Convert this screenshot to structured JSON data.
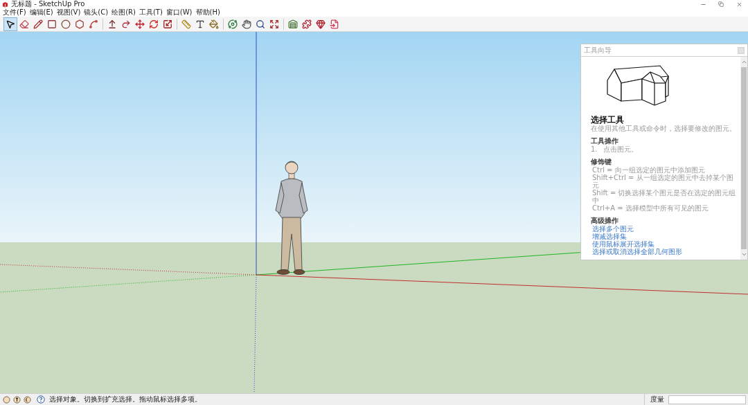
{
  "window": {
    "title": "无标题 - SketchUp Pro"
  },
  "menu_bar": [
    "文件(F)",
    "编辑(E)",
    "视图(V)",
    "镜头(C)",
    "绘图(R)",
    "工具(T)",
    "窗口(W)",
    "帮助(H)"
  ],
  "toolbar": {
    "groups": [
      [
        {
          "kind": "select",
          "selected": true
        },
        {
          "kind": "eraser",
          "selected": false
        },
        {
          "kind": "line",
          "selected": false
        },
        {
          "kind": "rectangle",
          "selected": false
        },
        {
          "kind": "circle",
          "selected": false
        },
        {
          "kind": "polygon",
          "selected": false
        },
        {
          "kind": "arc",
          "selected": false
        }
      ],
      [
        {
          "kind": "push_pull",
          "selected": false
        },
        {
          "kind": "follow_me",
          "selected": false
        },
        {
          "kind": "move",
          "selected": false
        },
        {
          "kind": "rotate",
          "selected": false
        },
        {
          "kind": "scale",
          "selected": false
        }
      ],
      [
        {
          "kind": "tape",
          "selected": false
        },
        {
          "kind": "text",
          "selected": false
        },
        {
          "kind": "paint",
          "selected": false
        }
      ],
      [
        {
          "kind": "orbit",
          "selected": false
        },
        {
          "kind": "pan",
          "selected": false
        },
        {
          "kind": "zoom",
          "selected": false
        },
        {
          "kind": "zoom_extents",
          "selected": false
        }
      ],
      [
        {
          "kind": "warehouse",
          "selected": false
        },
        {
          "kind": "extension_warehouse",
          "selected": false
        },
        {
          "kind": "extension_manager",
          "selected": false
        },
        {
          "kind": "layout",
          "selected": false
        }
      ]
    ]
  },
  "tool_guide": {
    "title": "工具向导",
    "tool_name": "选择工具",
    "description": "在使用其他工具或命令时，选择要修改的图元。",
    "sections": [
      {
        "kind": "steps",
        "heading": "工具操作",
        "items": [
          {
            "number": "1.",
            "text": "点击图元。"
          }
        ]
      },
      {
        "kind": "keys",
        "heading": "修饰键",
        "items": [
          {
            "text": "Ctrl = 向一组选定的图元中添加图元"
          },
          {
            "text": "Shift+Ctrl = 从一组选定的图元中去掉某个图元"
          },
          {
            "text": "Shift = 切换选择某个图元是否在选定的图元组中"
          },
          {
            "text": "Ctrl+A = 选择模型中所有可见的图元"
          }
        ]
      },
      {
        "kind": "links",
        "heading": "高级操作",
        "items": [
          {
            "text": "选择多个图元"
          },
          {
            "text": "增减选择集"
          },
          {
            "text": "使用鼠标展开选择集"
          },
          {
            "text": "选择或取消选择全部几何图形"
          }
        ]
      }
    ]
  },
  "status_bar": {
    "message": "选择对象。切换到扩充选择。拖动鼠标选择多项。",
    "measurements_label": "度量"
  }
}
